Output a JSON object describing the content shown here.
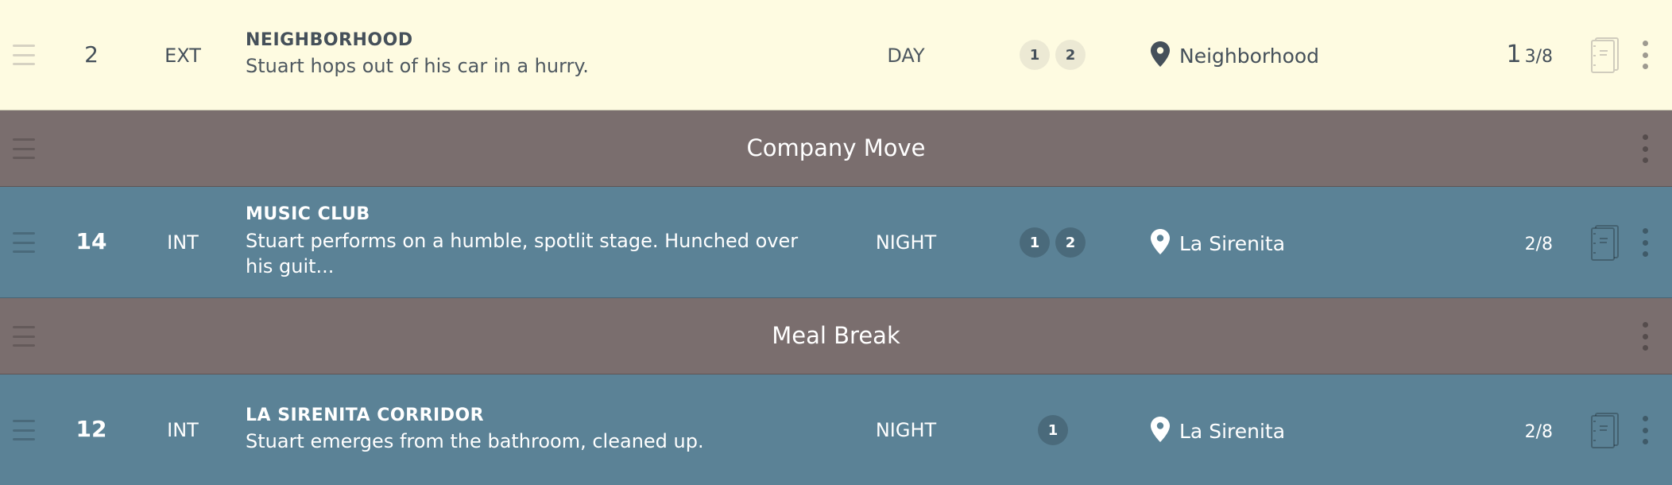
{
  "rows": [
    {
      "kind": "scene",
      "tone": "day",
      "scene_number": "2",
      "int_ext": "EXT",
      "set_heading": "NEIGHBORHOOD",
      "description": "Stuart hops out of his car in a hurry.",
      "time_of_day": "DAY",
      "cast_ids": [
        "1",
        "2"
      ],
      "location": "Neighborhood",
      "pages_whole": "1",
      "pages_fraction": "3/8",
      "icons": {
        "handle": "drag-handle-icon",
        "location": "map-pin-icon",
        "script": "script-pages-icon",
        "menu": "more-vertical-icon"
      }
    },
    {
      "kind": "banner",
      "label": "Company Move"
    },
    {
      "kind": "scene",
      "tone": "night",
      "scene_number": "14",
      "int_ext": "INT",
      "set_heading": "MUSIC CLUB",
      "description": "Stuart performs on a humble, spotlit stage. Hunched over his guit...",
      "time_of_day": "NIGHT",
      "cast_ids": [
        "1",
        "2"
      ],
      "location": "La Sirenita",
      "pages_whole": "",
      "pages_fraction": "2/8"
    },
    {
      "kind": "banner",
      "label": "Meal Break"
    },
    {
      "kind": "scene",
      "tone": "night",
      "scene_number": "12",
      "int_ext": "INT",
      "set_heading": "LA SIRENITA CORRIDOR",
      "description": "Stuart emerges from the bathroom, cleaned up.",
      "time_of_day": "NIGHT",
      "cast_ids": [
        "1"
      ],
      "location": "La Sirenita",
      "pages_whole": "",
      "pages_fraction": "2/8"
    }
  ],
  "colors": {
    "day_row": "#fefbe1",
    "night_row": "#5b8296",
    "banner_row": "#7a6e6e",
    "day_text": "#45505a"
  }
}
